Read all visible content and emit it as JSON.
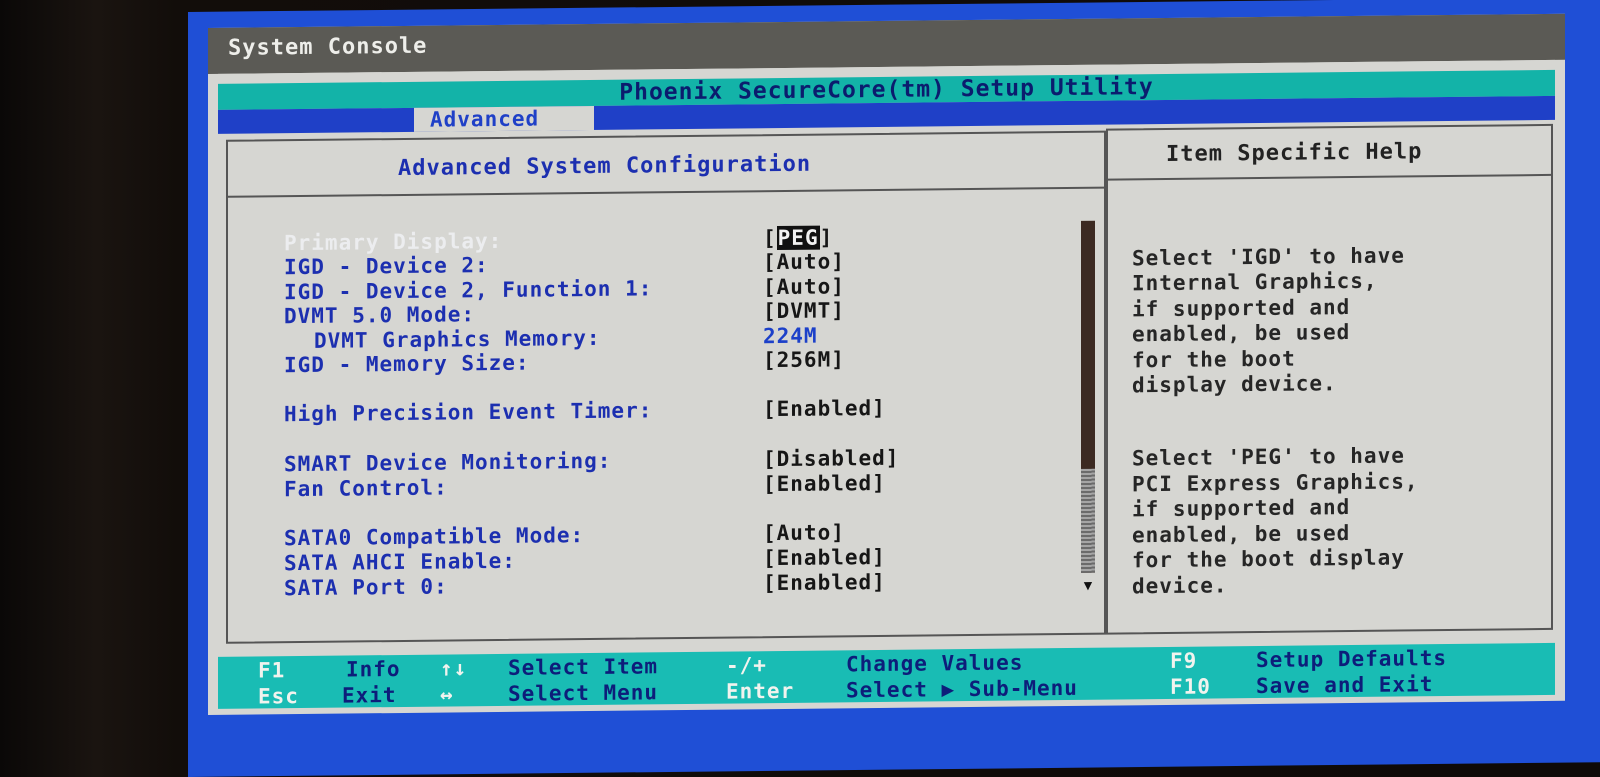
{
  "window": {
    "title": "System Console"
  },
  "utility_title": "Phoenix SecureCore(tm) Setup Utility",
  "menu": {
    "active_tab": "Advanced"
  },
  "panel": {
    "heading": "Advanced System Configuration",
    "items": [
      {
        "label": "Primary Display:",
        "value": "PEG",
        "selected": true,
        "indent": 0
      },
      {
        "label": "IGD - Device 2:",
        "value": "[Auto]",
        "indent": 0
      },
      {
        "label": "IGD - Device 2, Function 1:",
        "value": "[Auto]",
        "indent": 0
      },
      {
        "label": "DVMT 5.0 Mode:",
        "value": "[DVMT]",
        "indent": 0
      },
      {
        "label": "DVMT Graphics Memory:",
        "value": "224M",
        "indent": 1,
        "readonly": true
      },
      {
        "label": "IGD - Memory Size:",
        "value": "[256M]",
        "indent": 0
      },
      {
        "label": "High Precision Event Timer:",
        "value": "[Enabled]",
        "indent": 0
      },
      {
        "label": "SMART Device Monitoring:",
        "value": "[Disabled]",
        "indent": 0
      },
      {
        "label": "Fan Control:",
        "value": "[Enabled]",
        "indent": 0
      },
      {
        "label": "SATA0 Compatible Mode:",
        "value": "[Auto]",
        "indent": 0
      },
      {
        "label": "SATA AHCI Enable:",
        "value": "[Enabled]",
        "indent": 0
      },
      {
        "label": "SATA Port 0:",
        "value": "[Enabled]",
        "indent": 0
      }
    ]
  },
  "help": {
    "heading": "Item Specific Help",
    "paragraphs": [
      "Select 'IGD' to have\nInternal Graphics,\nif supported and\nenabled, be used\nfor the boot\ndisplay device.",
      "Select 'PEG' to have\nPCI Express Graphics,\nif supported and\nenabled, be used\nfor the boot display\ndevice."
    ]
  },
  "footer": {
    "f1_key": "F1",
    "f1_label": "Info",
    "esc_key": "Esc",
    "esc_label": "Exit",
    "updown_key": "↑↓",
    "updown_label": "Select Item",
    "leftright_key": "↔",
    "leftright_label": "Select Menu",
    "change_key": "-/+",
    "change_label": "Change Values",
    "enter_key": "Enter",
    "enter_label": "Select ▶ Sub-Menu",
    "f9_key": "F9",
    "f9_label": "Setup Defaults",
    "f10_key": "F10",
    "f10_label": "Save and Exit"
  },
  "colors": {
    "accent_teal": "#13b3a8",
    "menu_blue": "#1f40c7",
    "label_blue": "#1c2fb0"
  }
}
